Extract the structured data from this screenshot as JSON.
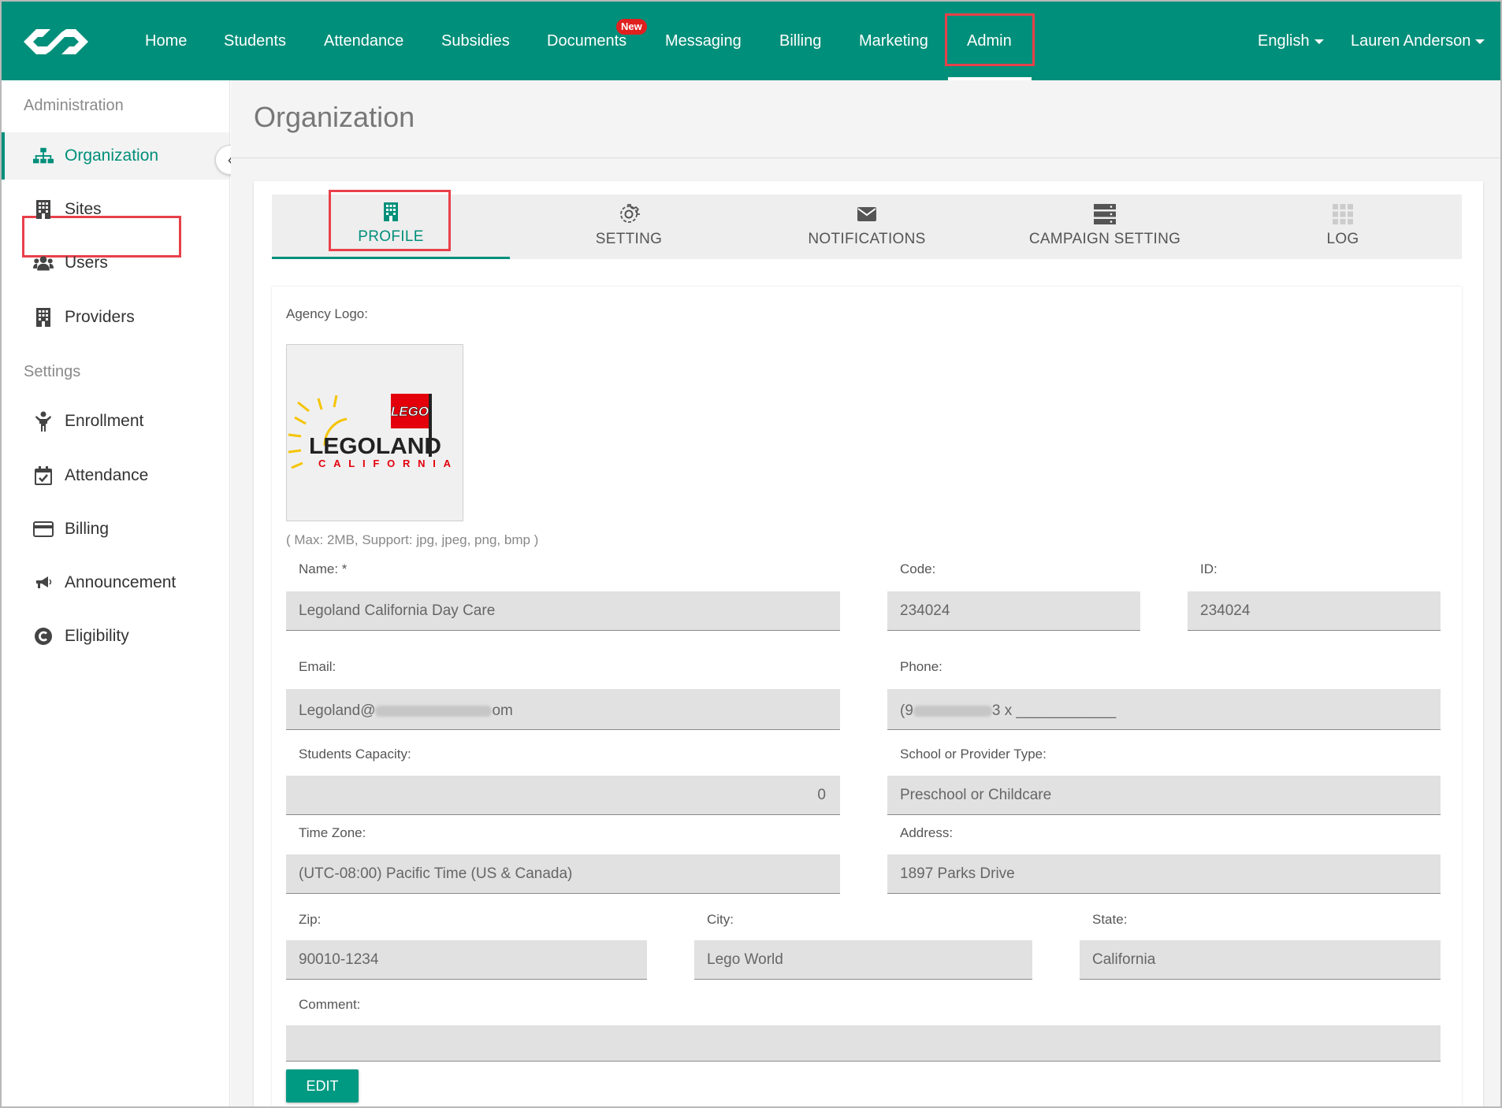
{
  "nav": {
    "items": [
      {
        "label": "Home"
      },
      {
        "label": "Students"
      },
      {
        "label": "Attendance"
      },
      {
        "label": "Subsidies"
      },
      {
        "label": "Documents"
      },
      {
        "label": "Messaging"
      },
      {
        "label": "Billing"
      },
      {
        "label": "Marketing"
      },
      {
        "label": "Admin"
      }
    ],
    "new_badge": "New",
    "language": "English",
    "user": "Lauren Anderson",
    "brand_color": "#008f7a",
    "highlight_color": "#e8404a"
  },
  "sidebar": {
    "administration_header": "Administration",
    "admin_items": [
      {
        "label": "Organization",
        "icon": "sitemap-icon"
      },
      {
        "label": "Sites",
        "icon": "building-icon"
      },
      {
        "label": "Users",
        "icon": "users-icon"
      },
      {
        "label": "Providers",
        "icon": "building-icon"
      }
    ],
    "settings_header": "Settings",
    "settings_items": [
      {
        "label": "Enrollment",
        "icon": "child-icon"
      },
      {
        "label": "Attendance",
        "icon": "calendar-check-icon"
      },
      {
        "label": "Billing",
        "icon": "credit-card-icon"
      },
      {
        "label": "Announcement",
        "icon": "bullhorn-icon"
      },
      {
        "label": "Eligibility",
        "icon": "copyright-icon"
      }
    ]
  },
  "page": {
    "title": "Organization",
    "tabs": [
      {
        "label": "PROFILE",
        "icon": "building-icon"
      },
      {
        "label": "SETTING",
        "icon": "gear-icon"
      },
      {
        "label": "NOTIFICATIONS",
        "icon": "envelope-icon"
      },
      {
        "label": "CAMPAIGN SETTING",
        "icon": "server-icon"
      },
      {
        "label": "LOG",
        "icon": "grid-icon"
      }
    ]
  },
  "form": {
    "agency_logo_label": "Agency Logo:",
    "logo": {
      "brand": "LEGO",
      "name": "LEGOLAND",
      "sub": "CALIFORNIA"
    },
    "logo_hint": "( Max: 2MB, Support: jpg, jpeg, png, bmp )",
    "name_label": "Name: *",
    "name_value": "Legoland California Day Care",
    "code_label": "Code:",
    "code_value": "234024",
    "id_label": "ID:",
    "id_value": "234024",
    "email_label": "Email:",
    "email_prefix": "Legoland@",
    "email_suffix": "om",
    "phone_label": "Phone:",
    "phone_prefix": "(9",
    "phone_suffix": "3 x ____________",
    "capacity_label": "Students Capacity:",
    "capacity_value": "0",
    "provider_type_label": "School or Provider Type:",
    "provider_type_value": "Preschool or Childcare",
    "timezone_label": "Time Zone:",
    "timezone_value": "(UTC-08:00) Pacific Time (US & Canada)",
    "address_label": "Address:",
    "address_value": "1897 Parks Drive",
    "zip_label": "Zip:",
    "zip_value": "90010-1234",
    "city_label": "City:",
    "city_value": "Lego World",
    "state_label": "State:",
    "state_value": "California",
    "comment_label": "Comment:",
    "comment_value": "",
    "edit_button": "EDIT"
  }
}
